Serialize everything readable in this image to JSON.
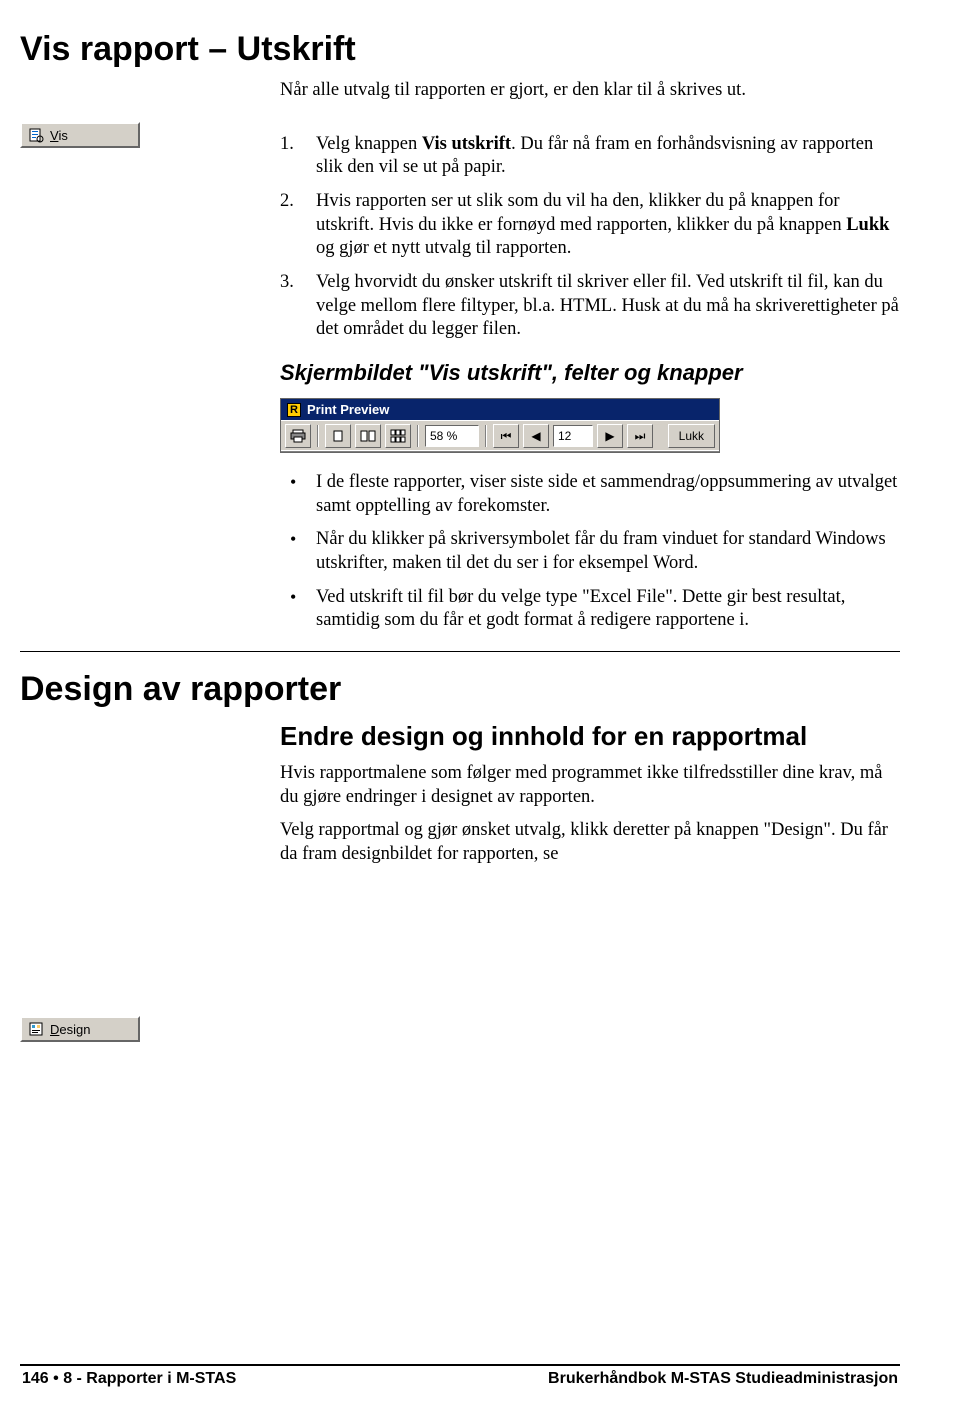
{
  "h1": "Vis rapport – Utskrift",
  "intro": "Når alle utvalg til rapporten er gjort, er den klar til å skrives ut.",
  "vis_btn": {
    "label_pre": "",
    "char": "V",
    "label_post": "is"
  },
  "steps": {
    "s1a": "Velg knappen ",
    "s1b": "Vis utskrift",
    "s1c": ". Du får nå fram en forhåndsvisning av rapporten slik den vil se ut på papir.",
    "s2a": "Hvis rapporten ser ut slik som du vil ha den, klikker du på knappen for utskrift. Hvis du ikke er fornøyd med rapporten, klikker du på knappen ",
    "s2b": "Lukk",
    "s2c": " og gjør et nytt utvalg til rapporten.",
    "s3": "Velg hvorvidt du ønsker utskrift til skriver eller fil. Ved utskrift til fil, kan du velge mellom flere filtyper, bl.a. HTML. Husk at du må ha skriverettigheter på det området du legger filen."
  },
  "subhead": "Skjermbildet \"Vis utskrift\", felter og knapper",
  "preview": {
    "window_title": "Print Preview",
    "zoom": "58 %",
    "page": "12",
    "close_label": "Lukk"
  },
  "bullets": {
    "b1": "I de fleste rapporter, viser siste side et sammendrag/oppsummering av utvalget samt opptelling av forekomster.",
    "b2": "Når du klikker på skriversymbolet får du fram vinduet for standard Windows utskrifter, maken til det du ser i for eksempel Word.",
    "b3": "Ved utskrift til fil bør du velge type \"Excel File\". Dette gir best resultat, samtidig som du får et godt format å redigere rapportene i."
  },
  "section2": "Design av rapporter",
  "sub3": "Endre design og innhold for en rapportmal",
  "design_btn": {
    "char": "D",
    "label_post": "esign"
  },
  "p2a": "Hvis rapportmalene som følger med programmet ikke tilfredsstiller dine krav, må du gjøre endringer i designet av rapporten.",
  "p2b": "Velg rapportmal og gjør ønsket utvalg, klikk deretter på knappen \"Design\". Du får da fram designbildet for rapporten, se",
  "footer": {
    "left": "146 • 8 - Rapporter i M-STAS",
    "right": "Brukerhåndbok M-STAS Studieadministrasjon"
  }
}
